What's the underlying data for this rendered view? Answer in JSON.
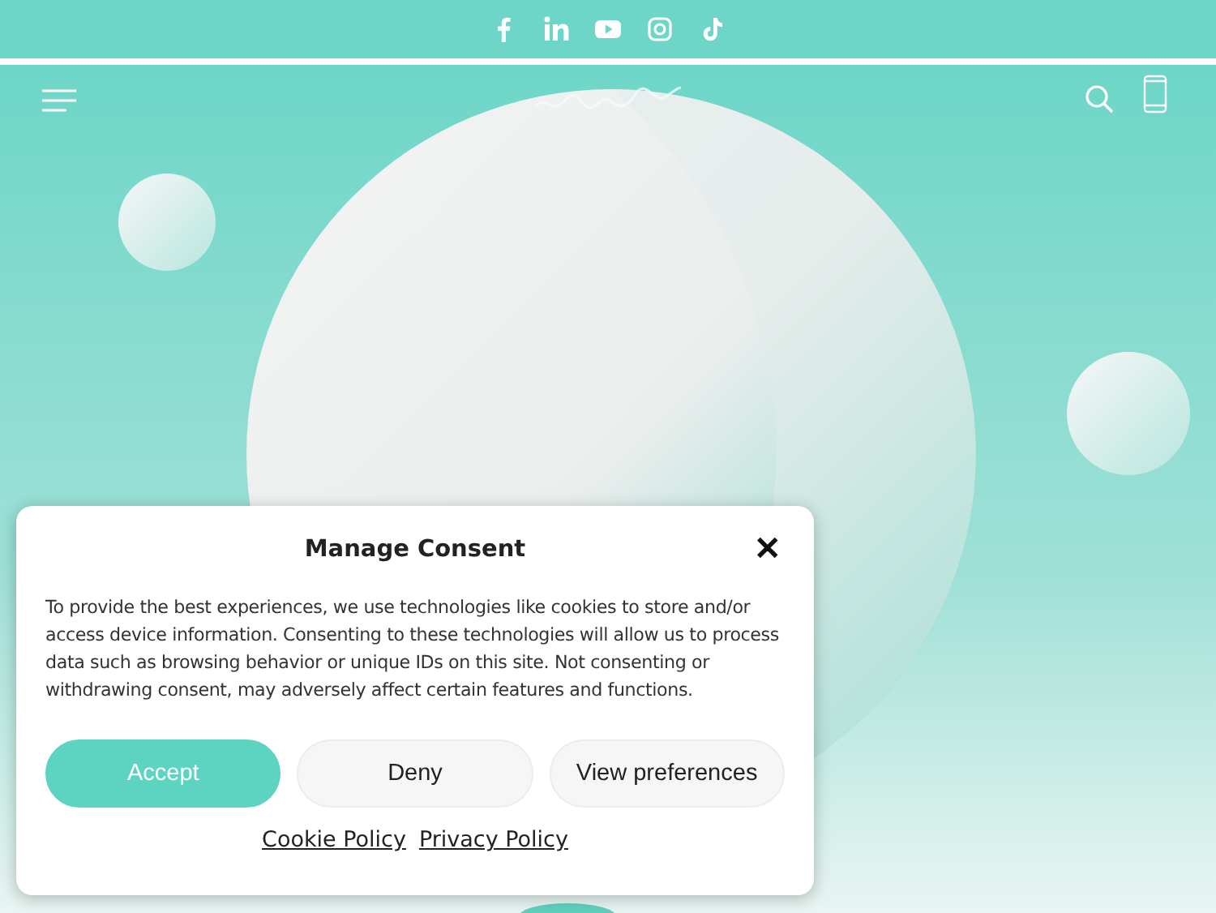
{
  "consent_dialog": {
    "title": "Manage Consent",
    "close": "✕",
    "message": "To provide the best experiences, we use technologies like cookies to store and/or access device information. Consenting to these technologies will allow us to process data such as browsing behavior or unique IDs on this site. Not consenting or withdrawing consent, may adversely affect certain features and functions.",
    "buttons": [
      {
        "label": "Accept",
        "kind": "primary"
      },
      {
        "label": "Deny",
        "kind": "secondary"
      },
      {
        "label": "View preferences",
        "kind": "secondary"
      }
    ],
    "links": [
      "Cookie Policy",
      "Privacy Policy"
    ]
  }
}
